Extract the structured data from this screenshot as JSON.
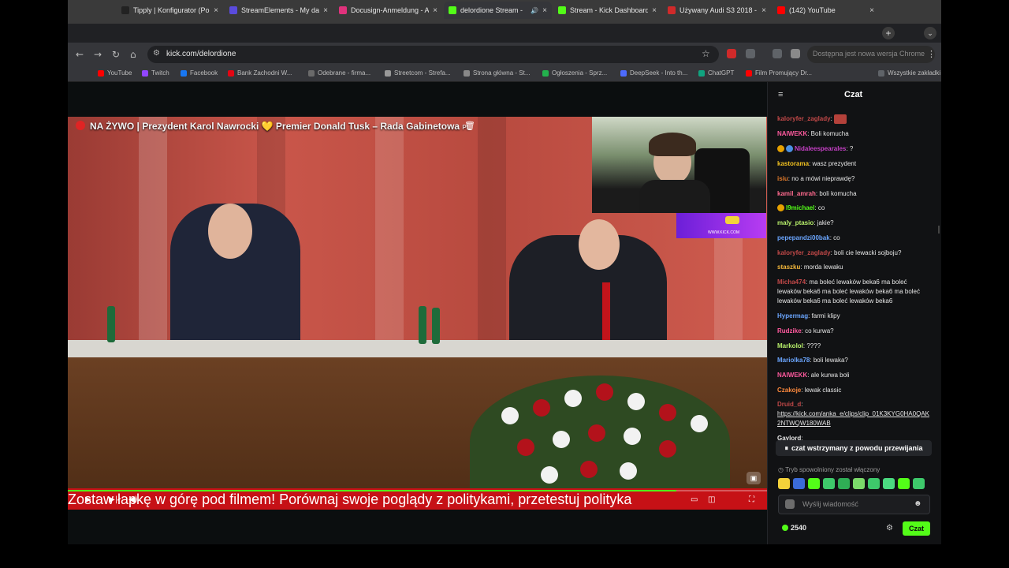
{
  "browser": {
    "tabs": [
      {
        "title": "Tipply | Konfigurator (Po",
        "favicon_color": "#222222"
      },
      {
        "title": "StreamElements - My da",
        "favicon_color": "#5a4bdc"
      },
      {
        "title": "Docusign-Anmeldung - A",
        "favicon_color": "#e0327c"
      },
      {
        "title": "delordione Stream - ",
        "favicon_color": "#53fc18",
        "active": true
      },
      {
        "title": "Stream - Kick Dashboard",
        "favicon_color": "#53fc18"
      },
      {
        "title": "Używany Audi S3 2018 -",
        "favicon_color": "#d02a2a"
      },
      {
        "title": "(142) YouTube",
        "favicon_color": "#ff0000"
      }
    ],
    "url": "kick.com/delordione",
    "update_notice": "Dostępna jest nowa wersja Chrome",
    "bookmarks": [
      {
        "label": "YouTube",
        "color": "#ff0000"
      },
      {
        "label": "Twitch",
        "color": "#9146ff"
      },
      {
        "label": "Facebook",
        "color": "#1877f2"
      },
      {
        "label": "Bank Zachodni W...",
        "color": "#e30613"
      },
      {
        "label": "Odebrane - firma...",
        "color": "#6a6a6a"
      },
      {
        "label": "Streetcom - Strefa...",
        "color": "#999999"
      },
      {
        "label": "Strona główna - St...",
        "color": "#888888"
      },
      {
        "label": "Ogłoszenia - Sprz...",
        "color": "#23b14d"
      },
      {
        "label": "DeepSeek - Into th...",
        "color": "#4d6bfe"
      },
      {
        "label": "ChatGPT",
        "color": "#10a37f"
      },
      {
        "label": "Film Promujący Dr...",
        "color": "#ff0000"
      }
    ],
    "all_bookmarks": "Wszystkie zakładki"
  },
  "video": {
    "title": "NA ŻYWO | Prezydent Karol Nawrocki 💛 Premier Donald Tusk – Rada Gabinetowa",
    "lang": "PL",
    "ticker": "Zostaw łapkę w górę pod filmem! Porównaj swoje poglądy z politykami, przetestuj polityka",
    "promo": "WWW.KICK.COM",
    "progress_fraction": 0.87
  },
  "chat": {
    "title": "Czat",
    "messages": [
      {
        "user": "kaloryfer_zaglady",
        "color": "#c14848",
        "text": "",
        "emote": true
      },
      {
        "user": "NAIWEKK",
        "color": "#ff5a9e",
        "text": "Boli komucha"
      },
      {
        "user": "Nidaleespearales",
        "color": "#c540c5",
        "text": "?",
        "badges": [
          "#e6a100",
          "#4a90e2"
        ]
      },
      {
        "user": "kastorama",
        "color": "#f0c020",
        "text": "wasz prezydent"
      },
      {
        "user": "isiu",
        "color": "#e07a2b",
        "text": "no a mówi nieprawdę?"
      },
      {
        "user": "kamil_amrah",
        "color": "#ff6a8e",
        "text": "boli komucha"
      },
      {
        "user": "I9michael",
        "color": "#53fc18",
        "text": "co",
        "badges": [
          "#e6a100"
        ]
      },
      {
        "user": "maly_ptasio",
        "color": "#b8f06b",
        "text": "jakie?"
      },
      {
        "user": "pepepandzi00bak",
        "color": "#6ba6ff",
        "text": "co"
      },
      {
        "user": "kaloryfer_zaglady",
        "color": "#c14848",
        "text": "boli cie lewacki sojboju?"
      },
      {
        "user": "staszku",
        "color": "#f2b63b",
        "text": "morda lewaku"
      },
      {
        "user": "Micha474",
        "color": "#c14848",
        "text": "ma boleć lewaków beka6 ma boleć lewaków beka6 ma boleć lewaków beka6 ma boleć lewaków beka6 ma boleć lewaków beka6"
      },
      {
        "user": "Hypermag",
        "color": "#6ba6ff",
        "text": "farmi klipy"
      },
      {
        "user": "Rudzike",
        "color": "#ff5a9e",
        "text": "co kurwa?"
      },
      {
        "user": "Markolol",
        "color": "#b8f06b",
        "text": "????"
      },
      {
        "user": "Mariolka78",
        "color": "#6ba6ff",
        "text": "boli lewaka?"
      },
      {
        "user": "NAIWEKK",
        "color": "#ff5a9e",
        "text": "ale kurwa boli"
      },
      {
        "user": "Czakoje",
        "color": "#ff8a3d",
        "text": "lewak classic"
      },
      {
        "user": "Druid_d",
        "color": "#c14848",
        "text": "",
        "link": "https://kick.com/anka_e/clips/clip_01K3KYG0HA0QAK2NTWQW180WAB"
      },
      {
        "user": "Gaylord",
        "color": "#e6e6e6",
        "text": ""
      }
    ],
    "paused_notice": "czat wstrzymany z powodu przewijania",
    "slow_mode_notice": "Tryb spowolniony został włączony",
    "input_placeholder": "Wyślij wiadomość",
    "points": "2540",
    "send_label": "Czat",
    "accent": "#53fc18"
  }
}
